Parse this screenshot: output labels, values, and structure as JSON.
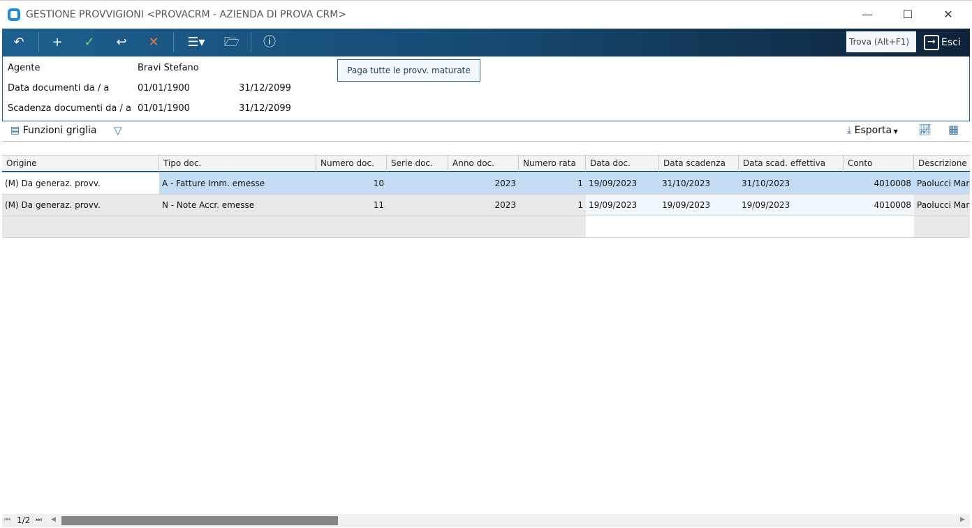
{
  "window": {
    "title": "GESTIONE PROVVIGIONI <PROVACRM - AZIENDA DI PROVA CRM>"
  },
  "toolbar": {
    "find_label": "Trova (Alt+F1)",
    "exit_label": "Esci"
  },
  "form": {
    "agent_label": "Agente",
    "agent_value": "Bravi Stefano",
    "doc_date_label": "Data documenti da / a",
    "doc_date_from": "01/01/1900",
    "doc_date_to": "31/12/2099",
    "due_date_label": "Scadenza documenti da / a",
    "due_date_from": "01/01/1900",
    "due_date_to": "31/12/2099",
    "pay_all_button": "Paga tutte le provv. maturate"
  },
  "gridbar": {
    "functions_label": "Funzioni griglia",
    "export_label": "Esporta"
  },
  "grid": {
    "columns": [
      "Origine",
      "Tipo doc.",
      "Numero doc.",
      "Serie doc.",
      "Anno doc.",
      "Numero rata",
      "Data doc.",
      "Data scadenza",
      "Data scad. effettiva",
      "Conto",
      "Descrizione conto"
    ],
    "rows": [
      [
        "(M) Da generaz. provv.",
        "A - Fatture Imm. emesse",
        "10",
        "",
        "2023",
        "1",
        "19/09/2023",
        "31/10/2023",
        "31/10/2023",
        "4010008",
        "Paolucci Marz"
      ],
      [
        "(M) Da generaz. provv.",
        "N - Note Accr. emesse",
        "11",
        "",
        "2023",
        "1",
        "19/09/2023",
        "19/09/2023",
        "19/09/2023",
        "4010008",
        "Paolucci Marz"
      ]
    ]
  },
  "pager": {
    "page": "1/2"
  },
  "colors": {
    "toolbar": "#1d5f8f",
    "selected_row": "#c5dcf5"
  }
}
